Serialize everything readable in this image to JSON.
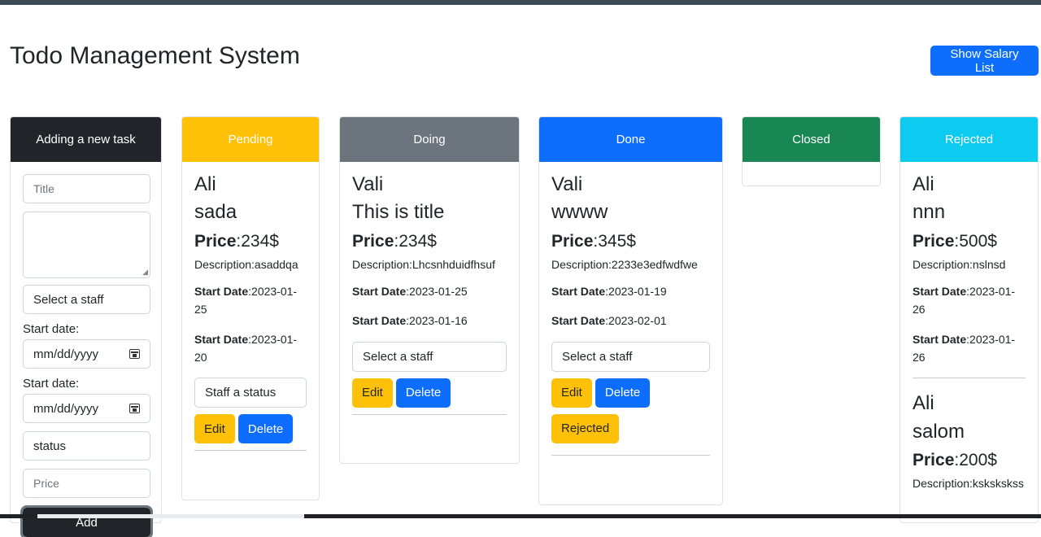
{
  "page": {
    "title": "Todo Management System",
    "salary_button": "Show Salary List"
  },
  "form": {
    "header": "Adding a new task",
    "title_placeholder": "Title",
    "staff_select": "Select a staff",
    "start_date_label_1": "Start date:",
    "date_placeholder_1": "mm/dd/yyyy",
    "start_date_label_2": "Start date:",
    "date_placeholder_2": "mm/dd/yyyy",
    "status_select": "status",
    "price_placeholder": "Price",
    "add_button": "Add"
  },
  "columns": {
    "pending": {
      "header": "Pending",
      "color": "#ffc107",
      "tasks": [
        {
          "name": "Ali",
          "title": "sada",
          "price_label": "Price",
          "price_value": ":234$",
          "description": "Description:asaddqa",
          "start_label_1": "Start Date",
          "start_value_1": ":2023-01-25",
          "start_label_2": "Start Date",
          "start_value_2": ":2023-01-20",
          "select": "Staff a status",
          "edit": "Edit",
          "delete": "Delete"
        }
      ]
    },
    "doing": {
      "header": "Doing",
      "color": "#6c757d",
      "tasks": [
        {
          "name": "Vali",
          "title": "This is title",
          "price_label": "Price",
          "price_value": ":234$",
          "description": "Description:Lhcsnhduidfhsuf",
          "start_label_1": "Start Date",
          "start_value_1": ":2023-01-25",
          "start_label_2": "Start Date",
          "start_value_2": ":2023-01-16",
          "select": "Select a staff",
          "edit": "Edit",
          "delete": "Delete"
        }
      ]
    },
    "done": {
      "header": "Done",
      "color": "#0d6efd",
      "tasks": [
        {
          "name": "Vali",
          "title": "wwww",
          "price_label": "Price",
          "price_value": ":345$",
          "description": "Description:2233e3edfwdfwe",
          "start_label_1": "Start Date",
          "start_value_1": ":2023-01-19",
          "start_label_2": "Start Date",
          "start_value_2": ":2023-02-01",
          "select": "Select a staff",
          "edit": "Edit",
          "delete": "Delete",
          "reject": "Rejected"
        }
      ]
    },
    "closed": {
      "header": "Closed",
      "color": "#198754",
      "tasks": []
    },
    "rejected": {
      "header": "Rejected",
      "color": "#0dcaf0",
      "tasks": [
        {
          "name": "Ali",
          "title": "nnn",
          "price_label": "Price",
          "price_value": ":500$",
          "description": "Description:nslnsd",
          "start_label_1": "Start Date",
          "start_value_1": ":2023-01-26",
          "start_label_2": "Start Date",
          "start_value_2": ":2023-01-26"
        },
        {
          "name": "Ali",
          "title": "salom",
          "price_label": "Price",
          "price_value": ":200$",
          "description": "Description:kskskskss"
        }
      ]
    }
  }
}
